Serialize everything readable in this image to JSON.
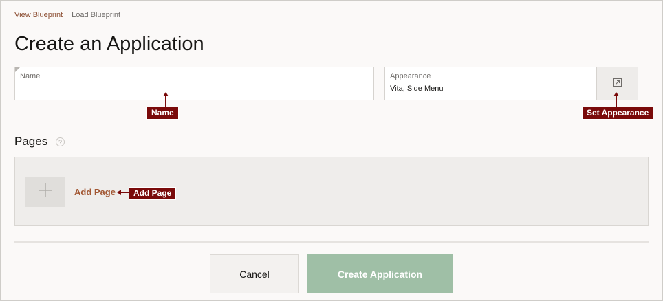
{
  "breadcrumbs": {
    "view_blueprint": "View Blueprint",
    "load_blueprint": "Load Blueprint"
  },
  "page_title": "Create an Application",
  "name_field": {
    "label": "Name",
    "value": "",
    "placeholder": ""
  },
  "appearance_field": {
    "label": "Appearance",
    "value": "Vita, Side Menu",
    "button_icon": "external-link-icon"
  },
  "callouts": {
    "name": "Name",
    "set_appearance": "Set Appearance",
    "add_page": "Add Page"
  },
  "pages_section": {
    "title": "Pages",
    "help_glyph": "?",
    "add_page_label": "Add Page",
    "add_icon": "plus-icon"
  },
  "footer": {
    "cancel_label": "Cancel",
    "create_label": "Create Application"
  },
  "colors": {
    "link_accent": "#a25733",
    "callout_bg": "#7a0a0a",
    "create_button_bg": "#9fbfa6"
  }
}
